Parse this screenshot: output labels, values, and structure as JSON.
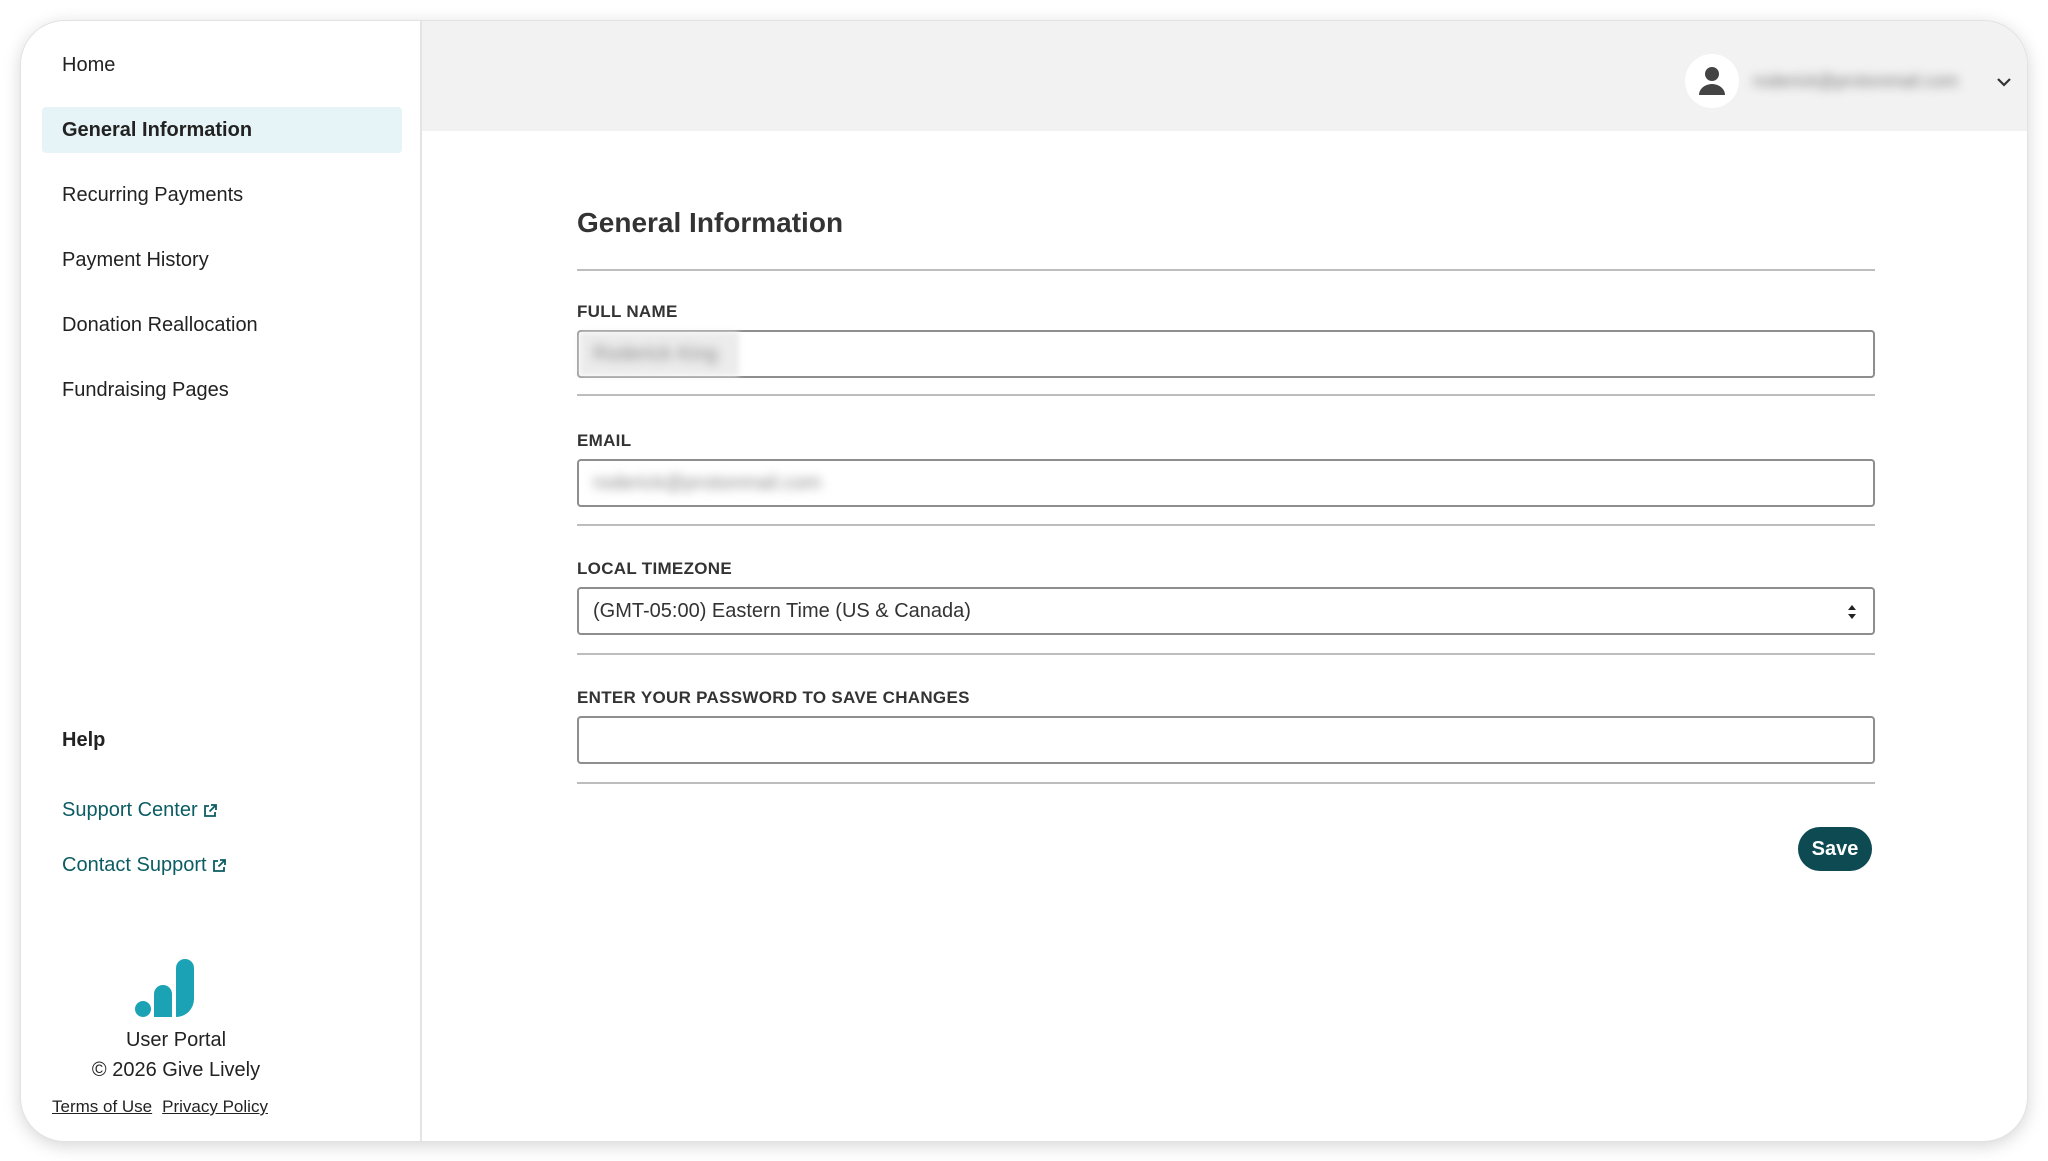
{
  "sidebar": {
    "items": [
      {
        "label": "Home"
      },
      {
        "label": "General Information"
      },
      {
        "label": "Recurring Payments"
      },
      {
        "label": "Payment History"
      },
      {
        "label": "Donation Reallocation"
      },
      {
        "label": "Fundraising Pages"
      }
    ],
    "help_title": "Help",
    "help_links": [
      {
        "label": "Support Center"
      },
      {
        "label": "Contact Support"
      }
    ],
    "portal_name": "User Portal",
    "copyright": "© 2026 Give Lively",
    "footer_links": {
      "terms": "Terms of Use",
      "privacy": "Privacy Policy"
    }
  },
  "header": {
    "user_email": "roderick@protonmail.com"
  },
  "main": {
    "title": "General Information",
    "fields": {
      "full_name": {
        "label": "FULL NAME",
        "value": "Roderick King"
      },
      "email": {
        "label": "EMAIL",
        "value": "roderick@protonmail.com"
      },
      "timezone": {
        "label": "LOCAL TIMEZONE",
        "value": "(GMT-05:00) Eastern Time (US & Canada)"
      },
      "password": {
        "label": "ENTER YOUR PASSWORD TO SAVE CHANGES",
        "value": ""
      }
    },
    "save_label": "Save"
  },
  "colors": {
    "accent": "#0d4a52",
    "link": "#0b5c63",
    "logo": "#1ba3b5",
    "active_bg": "#e6f4f7",
    "header_bg": "#f2f2f2"
  },
  "icons": {
    "user": "user-icon",
    "chevron": "chevron-down-icon",
    "external": "external-link-icon",
    "logo": "give-lively-logo",
    "select": "select-arrows-icon"
  }
}
